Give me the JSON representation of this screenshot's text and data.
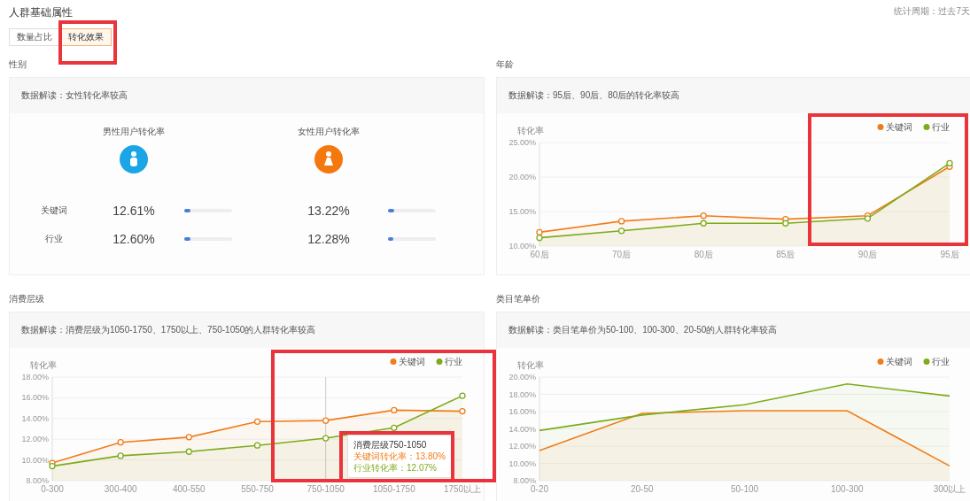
{
  "page": {
    "title": "人群基础属性",
    "period": "统计周期：过去7天"
  },
  "tabs": [
    {
      "label": "数量占比",
      "selected": false
    },
    {
      "label": "转化效果",
      "selected": true
    }
  ],
  "gender": {
    "label": "性别",
    "interpretation": "数据解读：女性转化率较高",
    "row_labels": [
      "关键词",
      "行业"
    ],
    "groups": [
      {
        "title": "男性用户转化率",
        "kind": "male",
        "rows": [
          {
            "value": "12.61%",
            "level": 0.13
          },
          {
            "value": "12.60%",
            "level": 0.13
          }
        ]
      },
      {
        "title": "女性用户转化率",
        "kind": "female",
        "rows": [
          {
            "value": "13.22%",
            "level": 0.13
          },
          {
            "value": "12.28%",
            "level": 0.12
          }
        ]
      }
    ]
  },
  "age": {
    "label": "年龄",
    "interpretation": "数据解读：95后、90后、80后的转化率较高",
    "chart_data": {
      "type": "area",
      "ylabel": "转化率",
      "categories": [
        "60后",
        "70后",
        "80后",
        "85后",
        "90后",
        "95后"
      ],
      "ylim": [
        10,
        25
      ],
      "grid": true,
      "legend": "top-right",
      "yticks": [
        {
          "value": 10,
          "label": "10.00%"
        },
        {
          "value": 15,
          "label": "15.00%"
        },
        {
          "value": 20,
          "label": "20.00%"
        },
        {
          "value": 25,
          "label": "25.00%"
        }
      ],
      "series": [
        {
          "name": "关键词",
          "color": "#f07d1a",
          "marker": "circle",
          "values": [
            12.0,
            13.6,
            14.4,
            13.9,
            14.4,
            21.5
          ]
        },
        {
          "name": "行业",
          "color": "#7cac1c",
          "marker": "circle",
          "values": [
            11.2,
            12.2,
            13.3,
            13.3,
            14.0,
            22.0
          ]
        }
      ]
    }
  },
  "consumption": {
    "label": "消费层级",
    "interpretation": "数据解读：消费层级为1050-1750、1750以上、750-1050的人群转化率较高",
    "chart_data": {
      "type": "area",
      "ylabel": "转化率",
      "categories": [
        "0-300",
        "300-400",
        "400-550",
        "550-750",
        "750-1050",
        "1050-1750",
        "1750以上"
      ],
      "ylim": [
        8,
        18
      ],
      "grid": true,
      "legend": "top-right",
      "yticks": [
        {
          "value": 8,
          "label": "8.00%"
        },
        {
          "value": 10,
          "label": "10.00%"
        },
        {
          "value": 12,
          "label": "12.00%"
        },
        {
          "value": 14,
          "label": "14.00%"
        },
        {
          "value": 16,
          "label": "16.00%"
        },
        {
          "value": 18,
          "label": "18.00%"
        }
      ],
      "series": [
        {
          "name": "关键词",
          "color": "#f07d1a",
          "marker": "circle",
          "values": [
            9.7,
            11.7,
            12.2,
            13.7,
            13.8,
            14.8,
            14.7
          ]
        },
        {
          "name": "行业",
          "color": "#7cac1c",
          "marker": "circle",
          "values": [
            9.4,
            10.4,
            10.8,
            11.4,
            12.1,
            13.1,
            16.2
          ]
        }
      ],
      "ref_lines": [
        {
          "axis": "x",
          "value": "750-1050"
        }
      ]
    },
    "tooltip": {
      "title": "消费层级750-1050",
      "lines": [
        "关键词转化率：13.80%",
        "行业转化率：12.07%"
      ]
    }
  },
  "price": {
    "label": "类目笔单价",
    "interpretation": "数据解读：类目笔单价为50-100、100-300、20-50的人群转化率较高",
    "chart_data": {
      "type": "area",
      "ylabel": "转化率",
      "categories": [
        "0-20",
        "20-50",
        "50-100",
        "100-300",
        "300以上"
      ],
      "ylim": [
        8,
        20
      ],
      "grid": true,
      "legend": "top-right",
      "yticks": [
        {
          "value": 8,
          "label": "8.00%"
        },
        {
          "value": 10,
          "label": "10.00%"
        },
        {
          "value": 12,
          "label": "12.00%"
        },
        {
          "value": 14,
          "label": "14.00%"
        },
        {
          "value": 16,
          "label": "16.00%"
        },
        {
          "value": 18,
          "label": "18.00%"
        },
        {
          "value": 20,
          "label": "20.00%"
        }
      ],
      "series": [
        {
          "name": "关键词",
          "color": "#f07d1a",
          "values": [
            11.5,
            15.8,
            16.1,
            16.1,
            9.7
          ]
        },
        {
          "name": "行业",
          "color": "#7cac1c",
          "values": [
            13.8,
            15.6,
            16.8,
            19.2,
            17.8
          ]
        }
      ]
    }
  },
  "highlight_frames": [
    {
      "kind": "tabs"
    },
    {
      "kind": "age_right"
    },
    {
      "kind": "consumption_right"
    },
    {
      "kind": "tooltip"
    }
  ]
}
